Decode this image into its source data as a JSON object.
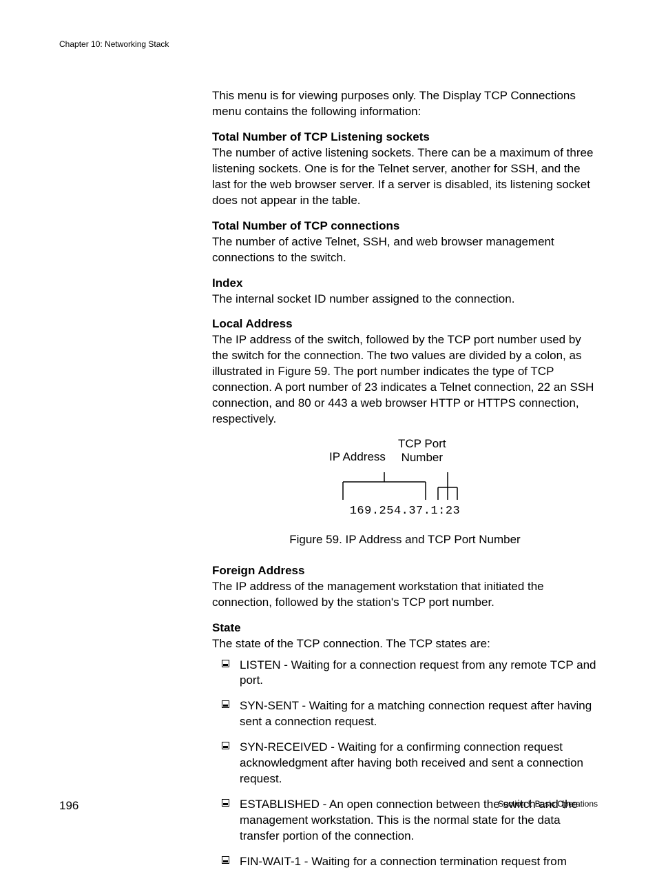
{
  "header": {
    "chapter": "Chapter 10: Networking Stack"
  },
  "intro": "This menu is for viewing purposes only. The Display TCP Connections menu contains the following information:",
  "sections": {
    "listening": {
      "title": "Total Number of TCP Listening sockets",
      "body": "The number of active listening sockets. There can be a maximum of three listening sockets. One is for the Telnet server, another for SSH, and the last for the web browser server. If a server is disabled, its listening socket does not appear in the table."
    },
    "connections": {
      "title": "Total Number of TCP connections",
      "body": "The number of active Telnet, SSH, and web browser management connections to the switch."
    },
    "index": {
      "title": "Index",
      "body": "The internal socket ID number assigned to the connection."
    },
    "local": {
      "title": "Local Address",
      "body": "The IP address of the switch, followed by the TCP port number used by the switch for the connection. The two values are divided by a colon, as illustrated in Figure 59. The port number indicates the type of TCP connection. A port number of 23 indicates a Telnet connection, 22 an SSH connection, and 80 or 443 a web browser HTTP or HTTPS connection, respectively."
    },
    "foreign": {
      "title": "Foreign Address",
      "body": "The IP address of the management workstation that initiated the connection, followed by the station's TCP port number."
    },
    "state": {
      "title": "State",
      "body": "The state of the TCP connection. The TCP states are:"
    }
  },
  "figure": {
    "ip_label": "IP Address",
    "tcp_label_1": "TCP Port",
    "tcp_label_2": "Number",
    "value": "169.254.37.1:23",
    "caption": "Figure 59. IP Address and TCP Port Number"
  },
  "states": [
    "LISTEN - Waiting for a connection request from any remote TCP and port.",
    "SYN-SENT - Waiting for a matching connection request after having sent a connection request.",
    "SYN-RECEIVED - Waiting for a confirming connection request acknowledgment after having both received and sent a connection request.",
    "ESTABLISHED - An open connection between the switch and the management workstation. This is the normal state for the data transfer portion of the connection.",
    "FIN-WAIT-1 - Waiting for a connection termination request from"
  ],
  "footer": {
    "page": "196",
    "section": "Section I: Basic Operations"
  }
}
